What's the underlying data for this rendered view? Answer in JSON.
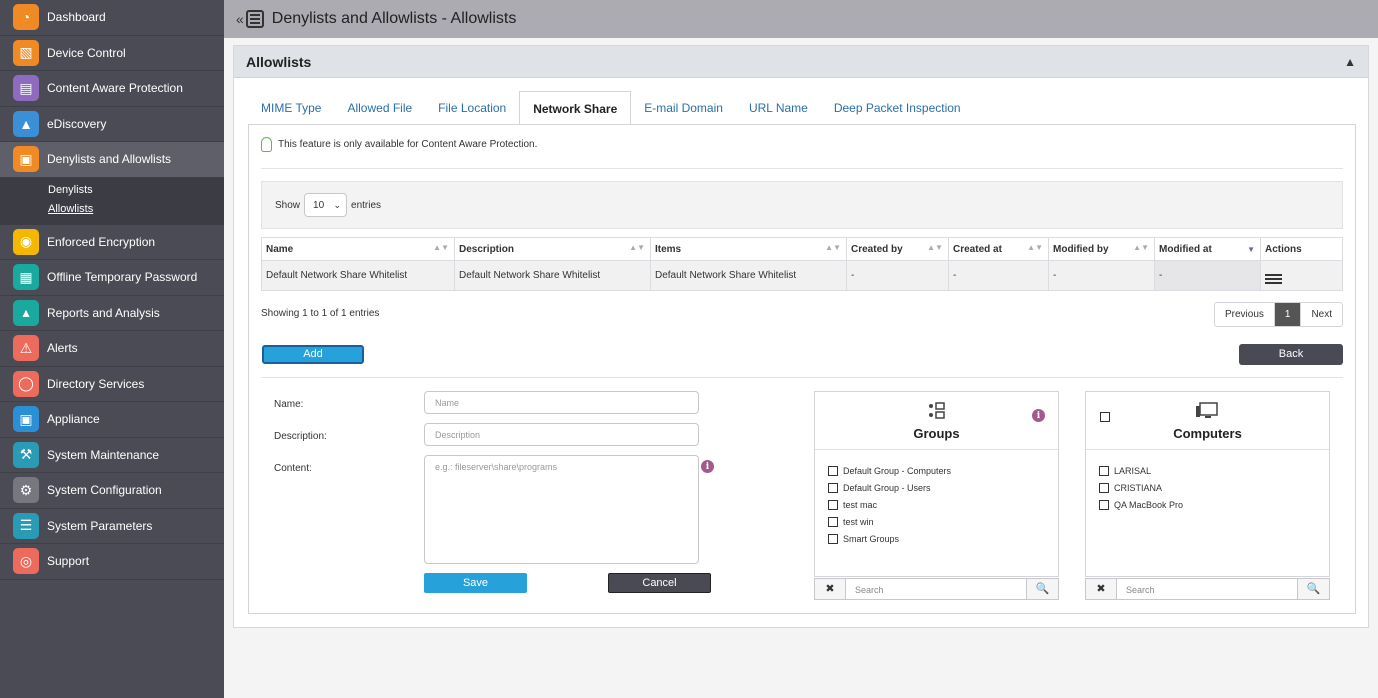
{
  "sidebar": {
    "items": [
      {
        "label": "Dashboard",
        "icon": "dashboard-icon",
        "color": "#f08a24"
      },
      {
        "label": "Device Control",
        "icon": "device-control-icon",
        "color": "#f08a24"
      },
      {
        "label": "Content Aware Protection",
        "icon": "content-aware-icon",
        "color": "#8e6bbf"
      },
      {
        "label": "eDiscovery",
        "icon": "ediscovery-icon",
        "color": "#3b8fd6"
      },
      {
        "label": "Denylists and Allowlists",
        "icon": "denylists-icon",
        "color": "#f08a24"
      },
      {
        "label": "Enforced Encryption",
        "icon": "encryption-icon",
        "color": "#f5b800"
      },
      {
        "label": "Offline Temporary Password",
        "icon": "password-icon",
        "color": "#19a99e"
      },
      {
        "label": "Reports and Analysis",
        "icon": "reports-icon",
        "color": "#19a99e"
      },
      {
        "label": "Alerts",
        "icon": "alert-icon",
        "color": "#ec6b5c"
      },
      {
        "label": "Directory Services",
        "icon": "directory-icon",
        "color": "#ec6b5c"
      },
      {
        "label": "Appliance",
        "icon": "appliance-icon",
        "color": "#2b8fd6"
      },
      {
        "label": "System Maintenance",
        "icon": "maintenance-icon",
        "color": "#2a9bb4"
      },
      {
        "label": "System Configuration",
        "icon": "gear-icon",
        "color": "#777780"
      },
      {
        "label": "System Parameters",
        "icon": "parameters-icon",
        "color": "#2a9bb4"
      },
      {
        "label": "Support",
        "icon": "support-icon",
        "color": "#ec6b5c"
      }
    ],
    "subitems": [
      "Denylists",
      "Allowlists"
    ]
  },
  "header": {
    "title": "Denylists and Allowlists - Allowlists"
  },
  "panel": {
    "title": "Allowlists"
  },
  "tabs": [
    "MIME Type",
    "Allowed File",
    "File Location",
    "Network Share",
    "E-mail Domain",
    "URL Name",
    "Deep Packet Inspection"
  ],
  "notice": "This feature is only available for Content Aware Protection.",
  "show": {
    "prefix": "Show",
    "value": "10",
    "suffix": "entries"
  },
  "table": {
    "headers": [
      "Name",
      "Description",
      "Items",
      "Created by",
      "Created at",
      "Modified by",
      "Modified at",
      "Actions"
    ],
    "rows": [
      [
        "Default Network Share Whitelist",
        "Default Network Share Whitelist",
        "Default Network Share Whitelist",
        "-",
        "-",
        "-",
        "-"
      ]
    ]
  },
  "showing": "Showing 1 to 1 of 1 entries",
  "pager": {
    "previous": "Previous",
    "page": "1",
    "next": "Next"
  },
  "buttons": {
    "add": "Add",
    "back": "Back",
    "save": "Save",
    "cancel": "Cancel"
  },
  "form": {
    "name_label": "Name:",
    "name_placeholder": "Name",
    "description_label": "Description:",
    "description_placeholder": "Description",
    "content_label": "Content:",
    "content_placeholder": "e.g.: fileserver\\share\\programs"
  },
  "groups": {
    "title": "Groups",
    "items": [
      "Default Group - Computers",
      "Default Group - Users",
      "test mac",
      "test win",
      "Smart Groups"
    ],
    "search_placeholder": "Search"
  },
  "computers": {
    "title": "Computers",
    "items": [
      "LARISAL",
      "CRISTIANA",
      "QA MacBook Pro"
    ],
    "search_placeholder": "Search"
  }
}
